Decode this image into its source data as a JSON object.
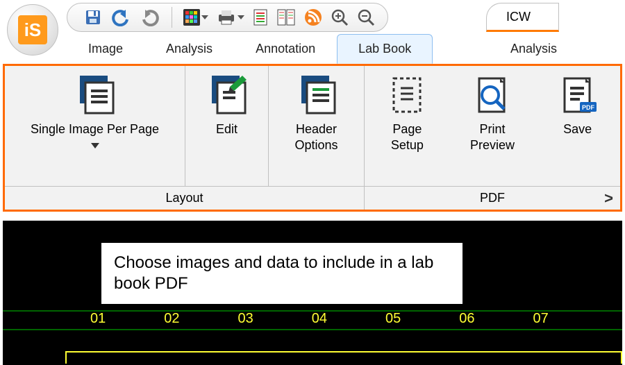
{
  "logo": "iS",
  "title_tab": "ICW",
  "tabs": [
    "Image",
    "Analysis",
    "Annotation",
    "Lab Book"
  ],
  "tabs_active": 3,
  "tabs2": [
    "Analysis"
  ],
  "ribbon": {
    "groups": [
      {
        "label": "Layout",
        "buttons": [
          {
            "label": "Single Image Per Page",
            "has_dropdown": true
          },
          {
            "label": "Edit"
          },
          {
            "label": "Header\nOptions"
          }
        ]
      },
      {
        "label": "PDF",
        "has_launcher": true,
        "buttons": [
          {
            "label": "Page\nSetup"
          },
          {
            "label": "Print\nPreview"
          },
          {
            "label": "Save"
          }
        ]
      }
    ]
  },
  "annotation_text": "Choose images and data to include in a lab book PDF",
  "lanes": [
    "01",
    "02",
    "03",
    "04",
    "05",
    "06",
    "07"
  ]
}
